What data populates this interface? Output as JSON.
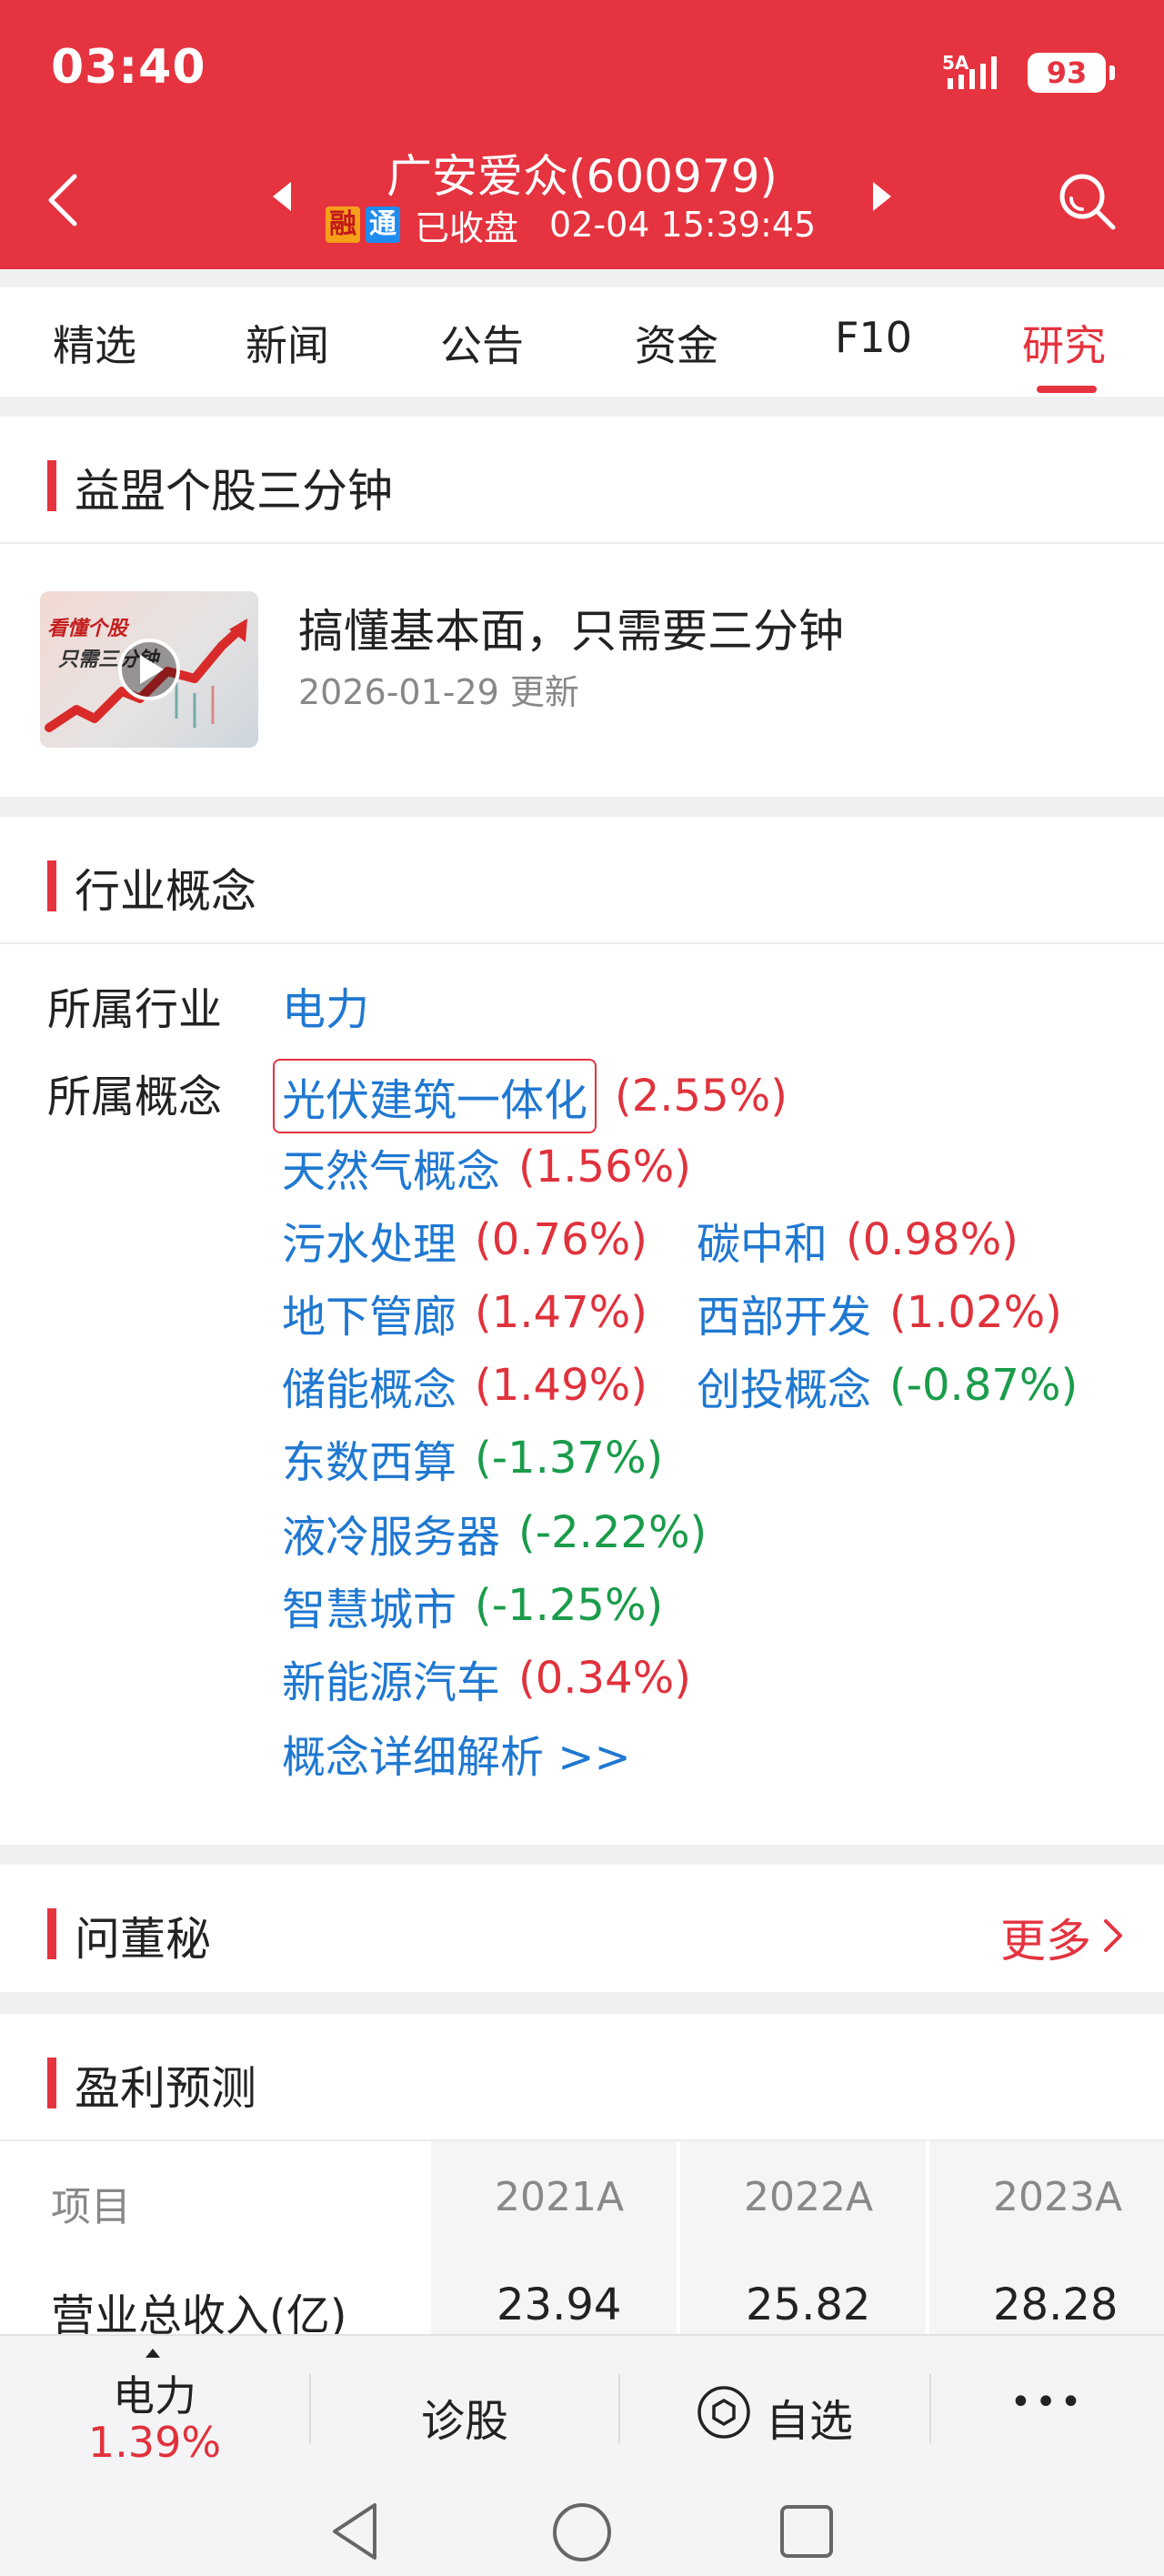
{
  "status_bar": {
    "time": "03:40",
    "network": "5A",
    "battery": "93"
  },
  "header": {
    "stock_title": "广安爱众(600979)",
    "tag_margin": "融",
    "tag_connect": "通",
    "market_status": "已收盘",
    "datetime": "02-04 15:39:45"
  },
  "tabs": [
    "精选",
    "新闻",
    "公告",
    "资金",
    "F10",
    "研究"
  ],
  "active_tab": "研究",
  "yimeng": {
    "title": "益盟个股三分钟",
    "video_title": "搞懂基本面，只需要三分钟",
    "video_date": "2026-01-29 更新",
    "thumb_text_1": "看懂个股",
    "thumb_text_2": "只需三分钟"
  },
  "industry": {
    "title": "行业概念",
    "industry_label": "所属行业",
    "industry_value": "电力",
    "concept_label": "所属概念",
    "concepts": [
      {
        "name": "光伏建筑一体化",
        "change": "(2.55%)"
      },
      {
        "name": "天然气概念",
        "change": "(1.56%)"
      },
      {
        "name": "污水处理",
        "change": "(0.76%)"
      },
      {
        "name": "碳中和",
        "change": "(0.98%)"
      },
      {
        "name": "地下管廊",
        "change": "(1.47%)"
      },
      {
        "name": "西部开发",
        "change": "(1.02%)"
      },
      {
        "name": "储能概念",
        "change": "(1.49%)"
      },
      {
        "name": "创投概念",
        "change": "(-0.87%)"
      },
      {
        "name": "东数西算",
        "change": "(-1.37%)"
      },
      {
        "name": "液冷服务器",
        "change": "(-2.22%)"
      },
      {
        "name": "智慧城市",
        "change": "(-1.25%)"
      },
      {
        "name": "新能源汽车",
        "change": "(0.34%)"
      }
    ],
    "detail_link": "概念详细解析 >>"
  },
  "qa": {
    "title": "问董秘",
    "more": "更多"
  },
  "forecast": {
    "title": "盈利预测",
    "headers": [
      "项目",
      "2021A",
      "2022A",
      "2023A"
    ],
    "rows": [
      {
        "label": "营业总收入(亿)",
        "values": [
          "23.94",
          "25.82",
          "28.28"
        ]
      }
    ]
  },
  "bottom_bar": {
    "sector_name": "电力",
    "sector_change": "1.39%",
    "diagnose": "诊股",
    "watchlist": "自选",
    "more": "•••"
  },
  "colors": {
    "brand_red": "#e5333f",
    "up": "#e0323c",
    "down": "#1a9c4a",
    "link_blue": "#1f78d1"
  }
}
